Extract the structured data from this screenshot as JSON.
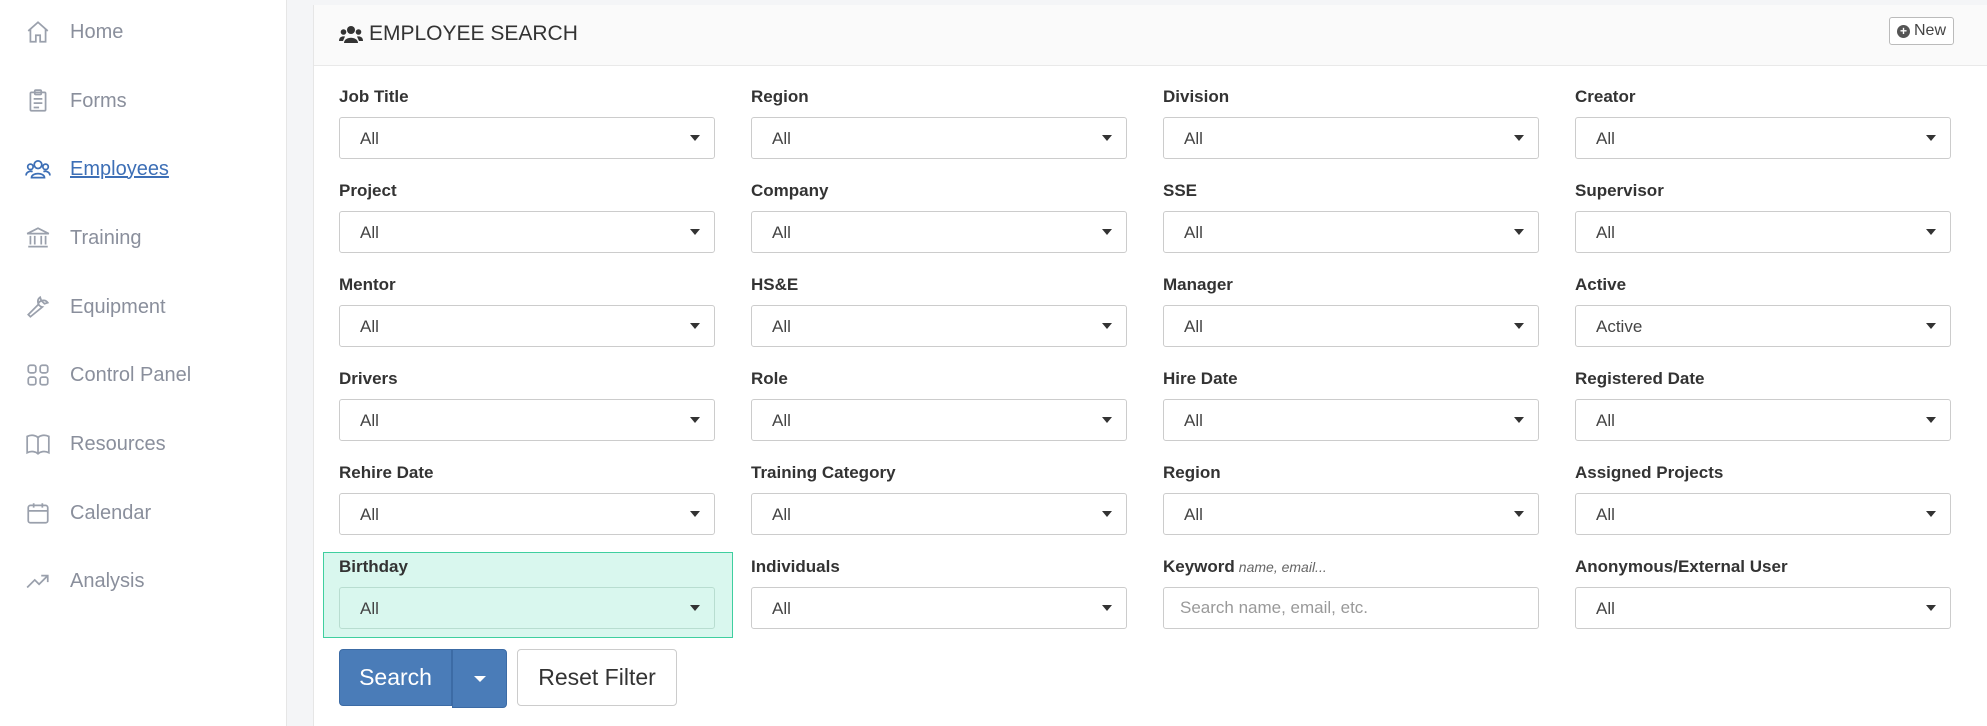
{
  "sidebar": {
    "items": [
      {
        "label": "Home",
        "icon": "home-icon"
      },
      {
        "label": "Forms",
        "icon": "clipboard-icon"
      },
      {
        "label": "Employees",
        "icon": "users-icon",
        "active": true
      },
      {
        "label": "Training",
        "icon": "building-columns-icon"
      },
      {
        "label": "Equipment",
        "icon": "wrench-icon"
      },
      {
        "label": "Control Panel",
        "icon": "grid-icon"
      },
      {
        "label": "Resources",
        "icon": "book-icon"
      },
      {
        "label": "Calendar",
        "icon": "calendar-icon"
      },
      {
        "label": "Analysis",
        "icon": "trend-icon"
      }
    ]
  },
  "panel": {
    "title": "EMPLOYEE SEARCH",
    "new_label": "New"
  },
  "filters": {
    "job_title": {
      "label": "Job Title",
      "value": "All"
    },
    "region": {
      "label": "Region",
      "value": "All"
    },
    "division": {
      "label": "Division",
      "value": "All"
    },
    "creator": {
      "label": "Creator",
      "value": "All"
    },
    "project": {
      "label": "Project",
      "value": "All"
    },
    "company": {
      "label": "Company",
      "value": "All"
    },
    "sse": {
      "label": "SSE",
      "value": "All"
    },
    "supervisor": {
      "label": "Supervisor",
      "value": "All"
    },
    "mentor": {
      "label": "Mentor",
      "value": "All"
    },
    "hse": {
      "label": "HS&E",
      "value": "All"
    },
    "manager": {
      "label": "Manager",
      "value": "All"
    },
    "active": {
      "label": "Active",
      "value": "Active"
    },
    "drivers": {
      "label": "Drivers",
      "value": "All"
    },
    "role": {
      "label": "Role",
      "value": "All"
    },
    "hire_date": {
      "label": "Hire Date",
      "value": "All"
    },
    "registered_date": {
      "label": "Registered Date",
      "value": "All"
    },
    "rehire_date": {
      "label": "Rehire Date",
      "value": "All"
    },
    "training_category": {
      "label": "Training Category",
      "value": "All"
    },
    "region2": {
      "label": "Region",
      "value": "All"
    },
    "assigned_projects": {
      "label": "Assigned Projects",
      "value": "All"
    },
    "birthday": {
      "label": "Birthday",
      "value": "All"
    },
    "individuals": {
      "label": "Individuals",
      "value": "All"
    },
    "keyword": {
      "label": "Keyword",
      "hint": "name, email...",
      "placeholder": "Search name, email, etc."
    },
    "anonymous": {
      "label": "Anonymous/External User",
      "value": "All"
    }
  },
  "actions": {
    "search_label": "Search",
    "reset_label": "Reset Filter"
  },
  "colors": {
    "accent": "#4a7cb8",
    "active_nav": "#3d6fb6",
    "highlight_bg": "#d9f7ee",
    "highlight_border": "#3fcf9f"
  }
}
